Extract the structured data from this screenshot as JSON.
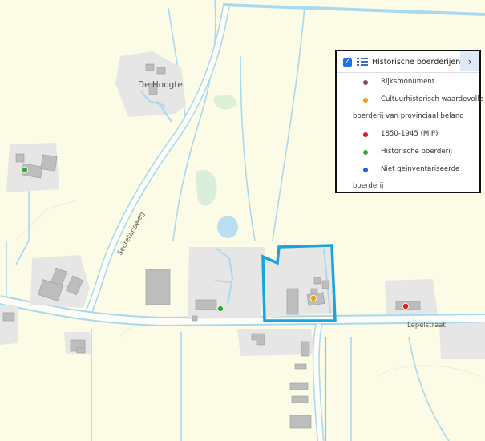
{
  "map": {
    "labels": {
      "farm_name": "De Hoogte",
      "road_secretarisweg": "Secretarisweg",
      "road_lepelstraat": "Lepelstraat"
    },
    "colors": {
      "land": "#fbfbe6",
      "water": "#b9e0f2",
      "water_edge": "#8fcbe6",
      "road": "#fdfdf8",
      "road_edge": "#a8d8ee",
      "yard": "#e6e6e6",
      "building": "#bdbdbd",
      "selection": "#19a4e0"
    },
    "markers": [
      {
        "category": "Historische boerderij",
        "color": "#33aa33"
      },
      {
        "category": "Historische boerderij",
        "color": "#33aa33"
      },
      {
        "category": "Cultuurhistorisch waardevolle boerderij van provinciaal belang",
        "color": "#e8a100"
      },
      {
        "category": "1850-1945 (MIP)",
        "color": "#e41a1a"
      }
    ]
  },
  "legend": {
    "checked": true,
    "layer_title": "Historische boerderijen",
    "items": [
      {
        "line1": "Rijksmonument",
        "line2": "",
        "color": "#8b4a4a"
      },
      {
        "line1": "Cultuurhistorisch waardevolle",
        "line2": "boerderij van provinciaal belang",
        "color": "#e8a100"
      },
      {
        "line1": "1850-1945 (MIP)",
        "line2": "",
        "color": "#e41a1a"
      },
      {
        "line1": "Historische boerderij",
        "line2": "",
        "color": "#33aa33"
      },
      {
        "line1": "Niet geinventariseerde",
        "line2": "boerderij",
        "color": "#1f5fe0"
      }
    ]
  }
}
